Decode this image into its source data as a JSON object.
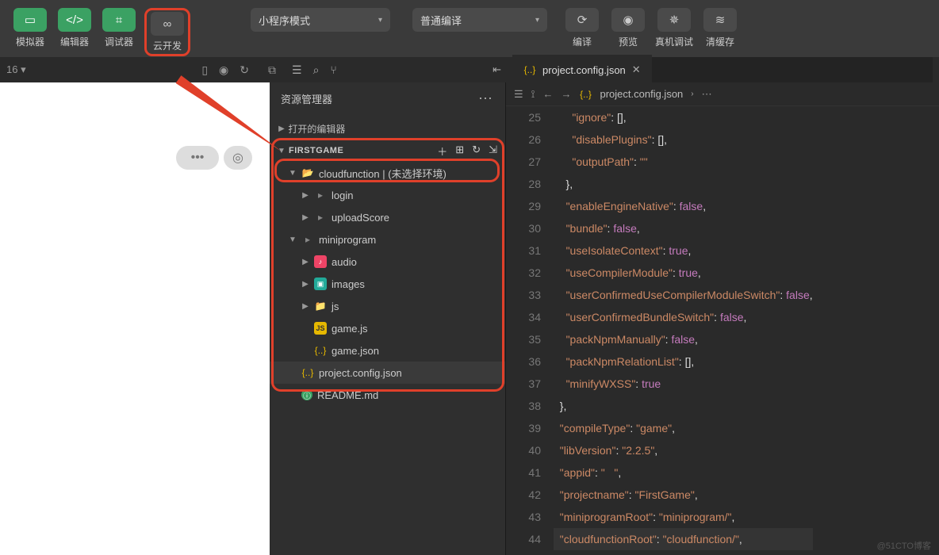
{
  "toolbar": {
    "simulator": "模拟器",
    "editor": "编辑器",
    "debugger": "调试器",
    "cloud": "云开发",
    "mode": "小程序模式",
    "compileMode": "普通编译",
    "compile": "编译",
    "preview": "预览",
    "realDebug": "真机调试",
    "clearCache": "清缓存"
  },
  "midstrip": {
    "zoom": "16 ▾"
  },
  "explorer": {
    "title": "资源管理器",
    "openEditors": "打开的编辑器",
    "project": "FIRSTGAME",
    "files": [
      {
        "name": "cloudfunction | (未选择环境)",
        "icon": "folder-open",
        "indent": 1,
        "expandable": true,
        "open": true
      },
      {
        "name": "login",
        "icon": "gray",
        "indent": 2,
        "expandable": true,
        "open": false
      },
      {
        "name": "uploadScore",
        "icon": "gray",
        "indent": 2,
        "expandable": true,
        "open": false
      },
      {
        "name": "miniprogram",
        "icon": "gray",
        "indent": 1,
        "expandable": true,
        "open": true
      },
      {
        "name": "audio",
        "icon": "audio",
        "indent": 2,
        "expandable": true,
        "open": false
      },
      {
        "name": "images",
        "icon": "img",
        "indent": 2,
        "expandable": true,
        "open": false
      },
      {
        "name": "js",
        "icon": "folder",
        "indent": 2,
        "expandable": true,
        "open": false
      },
      {
        "name": "game.js",
        "icon": "js",
        "indent": 2,
        "expandable": false
      },
      {
        "name": "game.json",
        "icon": "json",
        "indent": 2,
        "expandable": false
      },
      {
        "name": "project.config.json",
        "icon": "json",
        "indent": 1,
        "expandable": false,
        "selected": true
      },
      {
        "name": "README.md",
        "icon": "info",
        "indent": 1,
        "expandable": false
      }
    ]
  },
  "editor": {
    "tabFile": "project.config.json",
    "breadcrumb": "project.config.json",
    "startLine": 25,
    "lines": [
      [
        [
          "p",
          "      "
        ],
        [
          "key",
          "\"ignore\""
        ],
        [
          "p",
          ": []"
        ],
        [
          "p",
          ","
        ]
      ],
      [
        [
          "p",
          "      "
        ],
        [
          "key",
          "\"disablePlugins\""
        ],
        [
          "p",
          ": []"
        ],
        [
          "p",
          ","
        ]
      ],
      [
        [
          "p",
          "      "
        ],
        [
          "key",
          "\"outputPath\""
        ],
        [
          "p",
          ": "
        ],
        [
          "str",
          "\"\""
        ]
      ],
      [
        [
          "p",
          "    }"
        ],
        [
          "p",
          ","
        ]
      ],
      [
        [
          "p",
          "    "
        ],
        [
          "key",
          "\"enableEngineNative\""
        ],
        [
          "p",
          ": "
        ],
        [
          "kw",
          "false"
        ],
        [
          "p",
          ","
        ]
      ],
      [
        [
          "p",
          "    "
        ],
        [
          "key",
          "\"bundle\""
        ],
        [
          "p",
          ": "
        ],
        [
          "kw",
          "false"
        ],
        [
          "p",
          ","
        ]
      ],
      [
        [
          "p",
          "    "
        ],
        [
          "key",
          "\"useIsolateContext\""
        ],
        [
          "p",
          ": "
        ],
        [
          "kw",
          "true"
        ],
        [
          "p",
          ","
        ]
      ],
      [
        [
          "p",
          "    "
        ],
        [
          "key",
          "\"useCompilerModule\""
        ],
        [
          "p",
          ": "
        ],
        [
          "kw",
          "true"
        ],
        [
          "p",
          ","
        ]
      ],
      [
        [
          "p",
          "    "
        ],
        [
          "key",
          "\"userConfirmedUseCompilerModuleSwitch\""
        ],
        [
          "p",
          ": "
        ],
        [
          "kw",
          "false"
        ],
        [
          "p",
          ","
        ]
      ],
      [
        [
          "p",
          "    "
        ],
        [
          "key",
          "\"userConfirmedBundleSwitch\""
        ],
        [
          "p",
          ": "
        ],
        [
          "kw",
          "false"
        ],
        [
          "p",
          ","
        ]
      ],
      [
        [
          "p",
          "    "
        ],
        [
          "key",
          "\"packNpmManually\""
        ],
        [
          "p",
          ": "
        ],
        [
          "kw",
          "false"
        ],
        [
          "p",
          ","
        ]
      ],
      [
        [
          "p",
          "    "
        ],
        [
          "key",
          "\"packNpmRelationList\""
        ],
        [
          "p",
          ": []"
        ],
        [
          "p",
          ","
        ]
      ],
      [
        [
          "p",
          "    "
        ],
        [
          "key",
          "\"minifyWXSS\""
        ],
        [
          "p",
          ": "
        ],
        [
          "kw",
          "true"
        ]
      ],
      [
        [
          "p",
          "  }"
        ],
        [
          "p",
          ","
        ]
      ],
      [
        [
          "p",
          "  "
        ],
        [
          "key",
          "\"compileType\""
        ],
        [
          "p",
          ": "
        ],
        [
          "str",
          "\"game\""
        ],
        [
          "p",
          ","
        ]
      ],
      [
        [
          "p",
          "  "
        ],
        [
          "key",
          "\"libVersion\""
        ],
        [
          "p",
          ": "
        ],
        [
          "str",
          "\"2.2.5\""
        ],
        [
          "p",
          ","
        ]
      ],
      [
        [
          "p",
          "  "
        ],
        [
          "key",
          "\"appid\""
        ],
        [
          "p",
          ": "
        ],
        [
          "str",
          "\"   \""
        ],
        [
          "p",
          ","
        ]
      ],
      [
        [
          "p",
          "  "
        ],
        [
          "key",
          "\"projectname\""
        ],
        [
          "p",
          ": "
        ],
        [
          "str",
          "\"FirstGame\""
        ],
        [
          "p",
          ","
        ]
      ],
      [
        [
          "p",
          "  "
        ],
        [
          "key",
          "\"miniprogramRoot\""
        ],
        [
          "p",
          ": "
        ],
        [
          "str",
          "\"miniprogram/\""
        ],
        [
          "p",
          ","
        ]
      ],
      [
        [
          "p",
          "  "
        ],
        [
          "key",
          "\"cloudfunctionRoot\""
        ],
        [
          "p",
          ": "
        ],
        [
          "str",
          "\"cloudfunction/\""
        ],
        [
          "p",
          ","
        ]
      ]
    ]
  },
  "watermark": "@51CTO博客"
}
